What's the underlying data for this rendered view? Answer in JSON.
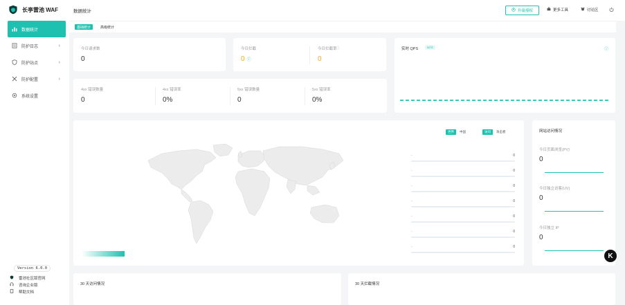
{
  "app": {
    "title": "长亭雷池 WAF"
  },
  "sidebar": {
    "items": [
      {
        "label": "数据统计",
        "icon": "chart-icon",
        "active": true,
        "has_children": false
      },
      {
        "label": "防护日志",
        "icon": "log-icon",
        "active": false,
        "has_children": true
      },
      {
        "label": "防护站点",
        "icon": "shield-icon",
        "active": false,
        "has_children": true
      },
      {
        "label": "防护配置",
        "icon": "tools-icon",
        "active": false,
        "has_children": true
      },
      {
        "label": "系统设置",
        "icon": "gear-icon",
        "active": false,
        "has_children": false
      }
    ],
    "version": "Version 6.0.0",
    "bottom_links": [
      {
        "label": "雷池社区版官网",
        "icon": "shield-icon"
      },
      {
        "label": "咨询企业版",
        "icon": "headset-icon"
      },
      {
        "label": "帮助文档",
        "icon": "doc-icon"
      }
    ]
  },
  "header": {
    "page_title": "数据统计",
    "upgrade_label": "升级授权",
    "more_tools_label": "更多工具",
    "discussion_label": "讨论区"
  },
  "subtabs": [
    {
      "label": "基础统计",
      "active": true
    },
    {
      "label": "高级统计",
      "active": false
    }
  ],
  "stats": {
    "requests_label": "今日请求数",
    "requests_value": "0",
    "blocked_label": "今日拦截",
    "blocked_value": "0",
    "block_rate_label": "今日拦截率",
    "block_rate_value": "0",
    "err4xx_count_label": "4xx 错误数量",
    "err4xx_count_value": "0",
    "err4xx_rate_label": "4xx 错误率",
    "err4xx_rate_value": "0%",
    "err5xx_count_label": "5xx 错误数量",
    "err5xx_count_value": "0",
    "err5xx_rate_label": "5xx 错误率",
    "err5xx_rate_value": "0%"
  },
  "qps": {
    "title": "实时 QPS",
    "badge": "sd 0"
  },
  "map": {
    "region_toggle": [
      "世界",
      "中国"
    ],
    "type_toggle": [
      "访问",
      "攻击者"
    ],
    "rank": [
      {
        "name": "-",
        "value": "0"
      },
      {
        "name": "-",
        "value": "0"
      },
      {
        "name": "-",
        "value": "0"
      },
      {
        "name": "-",
        "value": "0"
      },
      {
        "name": "-",
        "value": "0"
      },
      {
        "name": "-",
        "value": "0"
      },
      {
        "name": "-",
        "value": "0"
      }
    ]
  },
  "site_visits": {
    "title": "网站访问情况",
    "pv_label": "今日页面浏览(PV)",
    "pv_value": "0",
    "uv_label": "今日独立访客(UV)",
    "uv_value": "0",
    "ip_label": "今日独立 IP",
    "ip_value": "0"
  },
  "bottom_cards": {
    "visits_title": "30 天访问情况",
    "blocks_title": "30 天拦截情况"
  },
  "colors": {
    "accent": "#1ec1b0",
    "orange": "#f5a623"
  }
}
